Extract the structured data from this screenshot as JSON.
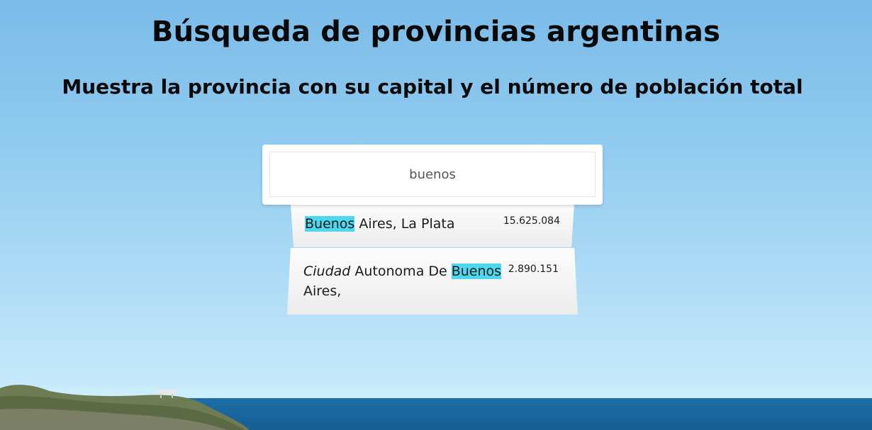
{
  "header": {
    "title": "Búsqueda de provincias argentinas",
    "subtitle": "Muestra la provincia con su capital y el número de población total"
  },
  "search": {
    "value": "buenos"
  },
  "results": [
    {
      "match": "Buenos",
      "rest": " Aires, La Plata",
      "population": "15.625.084"
    },
    {
      "prefix": "Ciudad",
      "middle": " Autonoma De ",
      "match": "Buenos",
      "rest": " Aires,",
      "population": "2.890.151"
    }
  ],
  "colors": {
    "highlight": "#4dd8ee",
    "sky": "#8ec9ef",
    "sea": "#1d6ea8"
  }
}
